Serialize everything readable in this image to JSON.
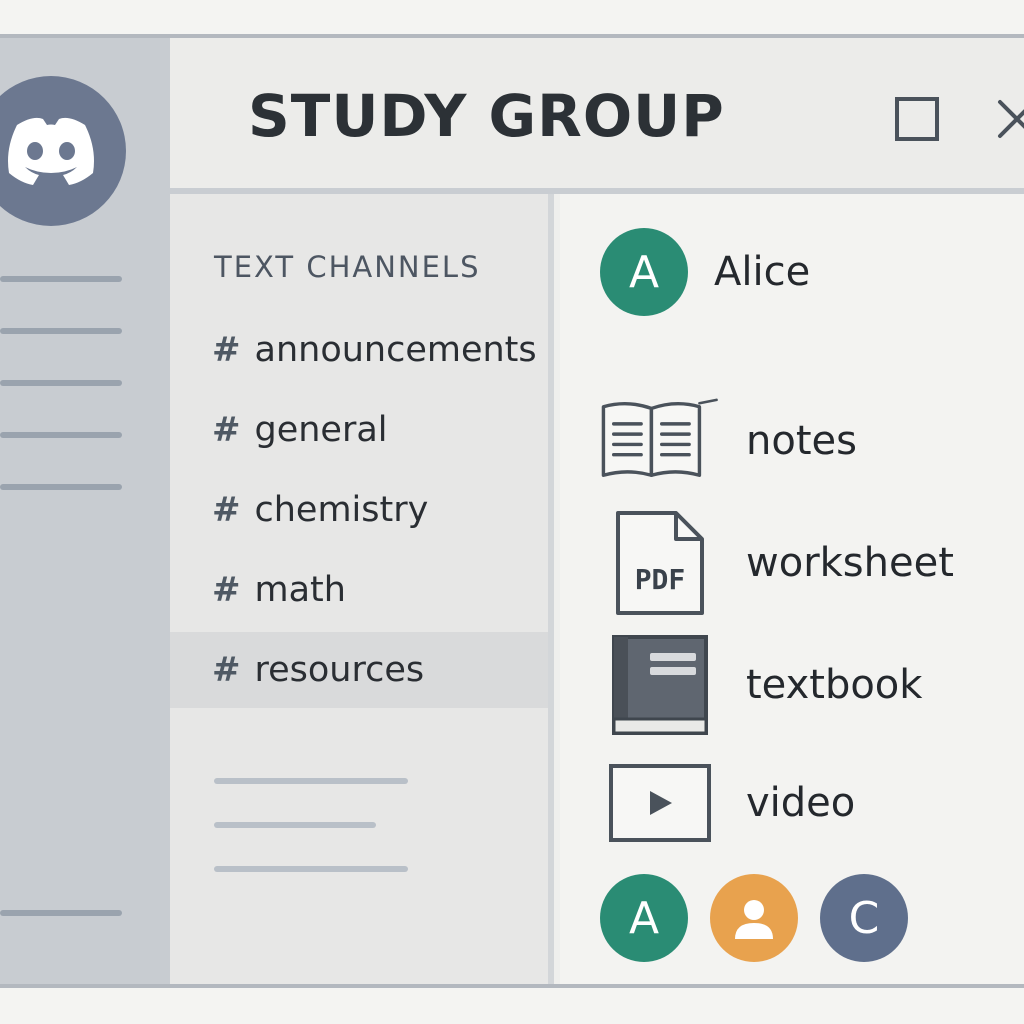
{
  "window": {
    "title": "STUDY GROUP"
  },
  "server": {
    "icon": "discord-logo-icon",
    "color": "#6c7890"
  },
  "channels": {
    "section_label": "TEXT CHANNELS",
    "items": [
      {
        "hash": "#",
        "name": "announcements",
        "active": false
      },
      {
        "hash": "#",
        "name": "general",
        "active": false
      },
      {
        "hash": "#",
        "name": "chemistry",
        "active": false
      },
      {
        "hash": "#",
        "name": "math",
        "active": false
      },
      {
        "hash": "#",
        "name": "resources",
        "active": true
      }
    ]
  },
  "content": {
    "user": {
      "initial": "A",
      "name": "Alice",
      "color": "#2a8c74"
    },
    "files": [
      {
        "icon": "open-book-icon",
        "label": "notes"
      },
      {
        "icon": "pdf-file-icon",
        "label": "worksheet",
        "icon_text": "PDF"
      },
      {
        "icon": "textbook-icon",
        "label": "textbook"
      },
      {
        "icon": "video-play-icon",
        "label": "video"
      }
    ],
    "members": [
      {
        "initial": "A",
        "color": "#2a8c74"
      },
      {
        "initial": "",
        "color": "#e8a24e",
        "icon": "user-silhouette-icon"
      },
      {
        "initial": "C",
        "color": "#5f6f8c"
      }
    ]
  }
}
